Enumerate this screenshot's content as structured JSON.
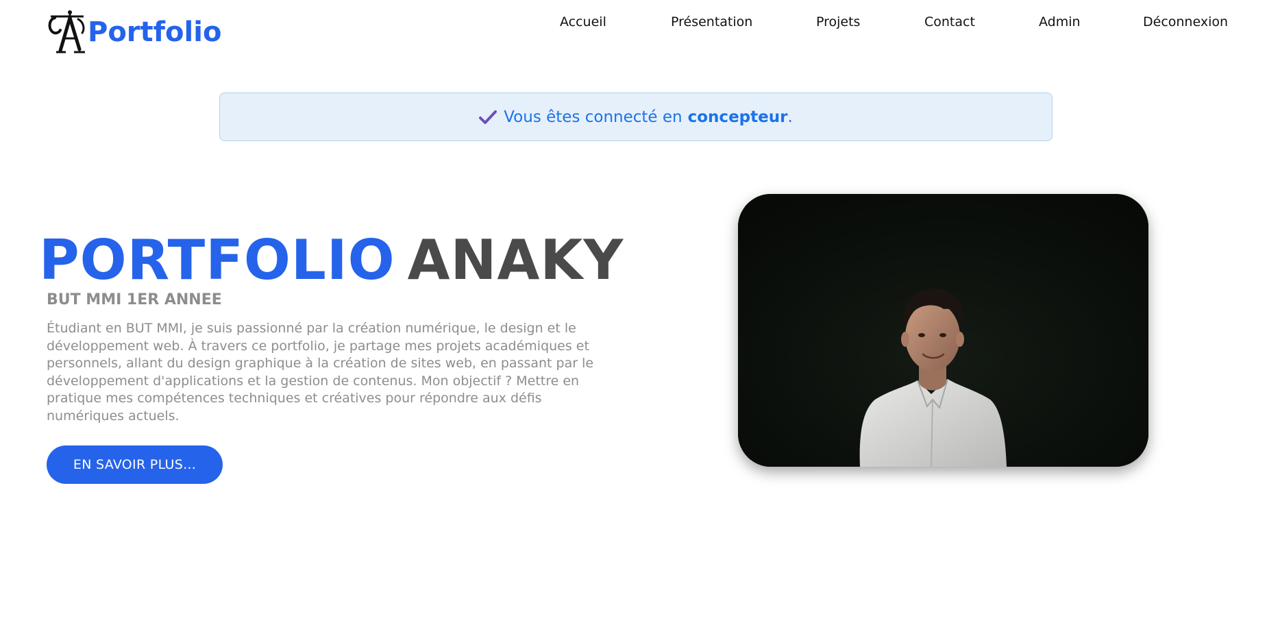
{
  "header": {
    "logo_text": "Portfolio",
    "logo_icon": "ornate-a-monogram",
    "nav": [
      {
        "label": "Accueil"
      },
      {
        "label": "Présentation"
      },
      {
        "label": "Projets"
      },
      {
        "label": "Contact"
      },
      {
        "label": "Admin"
      },
      {
        "label": "Déconnexion"
      }
    ]
  },
  "alert": {
    "icon": "check-icon",
    "message": "Vous êtes connecté en",
    "role": "concepteur",
    "suffix": "."
  },
  "hero": {
    "title_part1": "PORTFOLIO",
    "title_part2": "ANAKY",
    "subtitle": "BUT MMI 1ER ANNEE",
    "description": "Étudiant en BUT MMI, je suis passionné par la création numérique, le design et le développement web. À travers ce portfolio, je partage mes projets académiques et personnels, allant du design graphique à la création de sites web, en passant par le développement d'applications et la gestion de contenus. Mon objectif ? Mettre en pratique mes compétences techniques et créatives pour répondre aux défis numériques actuels.",
    "cta_label": "EN SAVOIR PLUS..."
  },
  "colors": {
    "brand_blue": "#2563eb",
    "alert_text": "#1a73e8",
    "alert_bg": "#e6f0fb",
    "title_dark": "#4a4a4a",
    "muted_text": "#8d8d8d",
    "check": "#6b4fbb"
  }
}
